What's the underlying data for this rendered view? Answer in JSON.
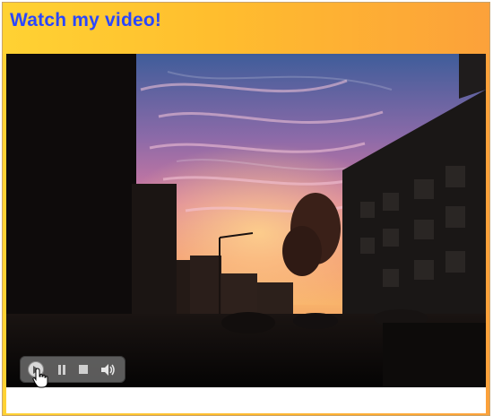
{
  "header": {
    "title": "Watch my video!"
  },
  "colors": {
    "title": "#2b47ff",
    "header_gradient_start": "#ffd233",
    "header_gradient_end": "#fca13a",
    "video_background": "#000000"
  },
  "video": {
    "scene": "sunset-street",
    "controls": {
      "play_icon": "play-icon",
      "pause_icon": "pause-icon",
      "stop_icon": "stop-icon",
      "volume_icon": "volume-icon"
    }
  },
  "cursor": {
    "icon": "hand-pointer-icon"
  }
}
